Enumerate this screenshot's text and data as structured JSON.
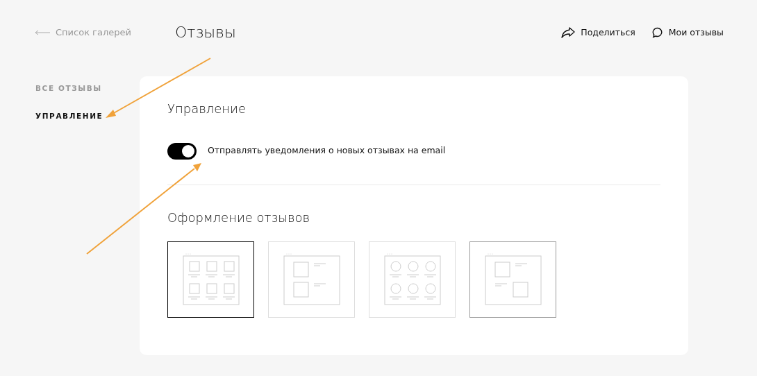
{
  "header": {
    "back_link": "Список галерей",
    "title": "Отзывы",
    "actions": [
      {
        "kind": "share",
        "label": "Поделиться"
      },
      {
        "kind": "comment",
        "label": "Мои отзывы"
      }
    ]
  },
  "sidebar": {
    "items": [
      {
        "label": "ВСЕ ОТЗЫВЫ",
        "selected": false
      },
      {
        "label": "УПРАВЛЕНИЕ",
        "selected": true
      }
    ]
  },
  "panel": {
    "title": "Управление",
    "toggle": {
      "label": "Отправлять уведомления о новых отзывах на email",
      "on": true
    },
    "design_title": "Оформление отзывов",
    "layouts": [
      {
        "kind": "grid-squares",
        "selected": true,
        "hovered": false
      },
      {
        "kind": "list",
        "selected": false,
        "hovered": false
      },
      {
        "kind": "grid-circles",
        "selected": false,
        "hovered": false
      },
      {
        "kind": "zigzag",
        "selected": false,
        "hovered": true
      }
    ]
  }
}
